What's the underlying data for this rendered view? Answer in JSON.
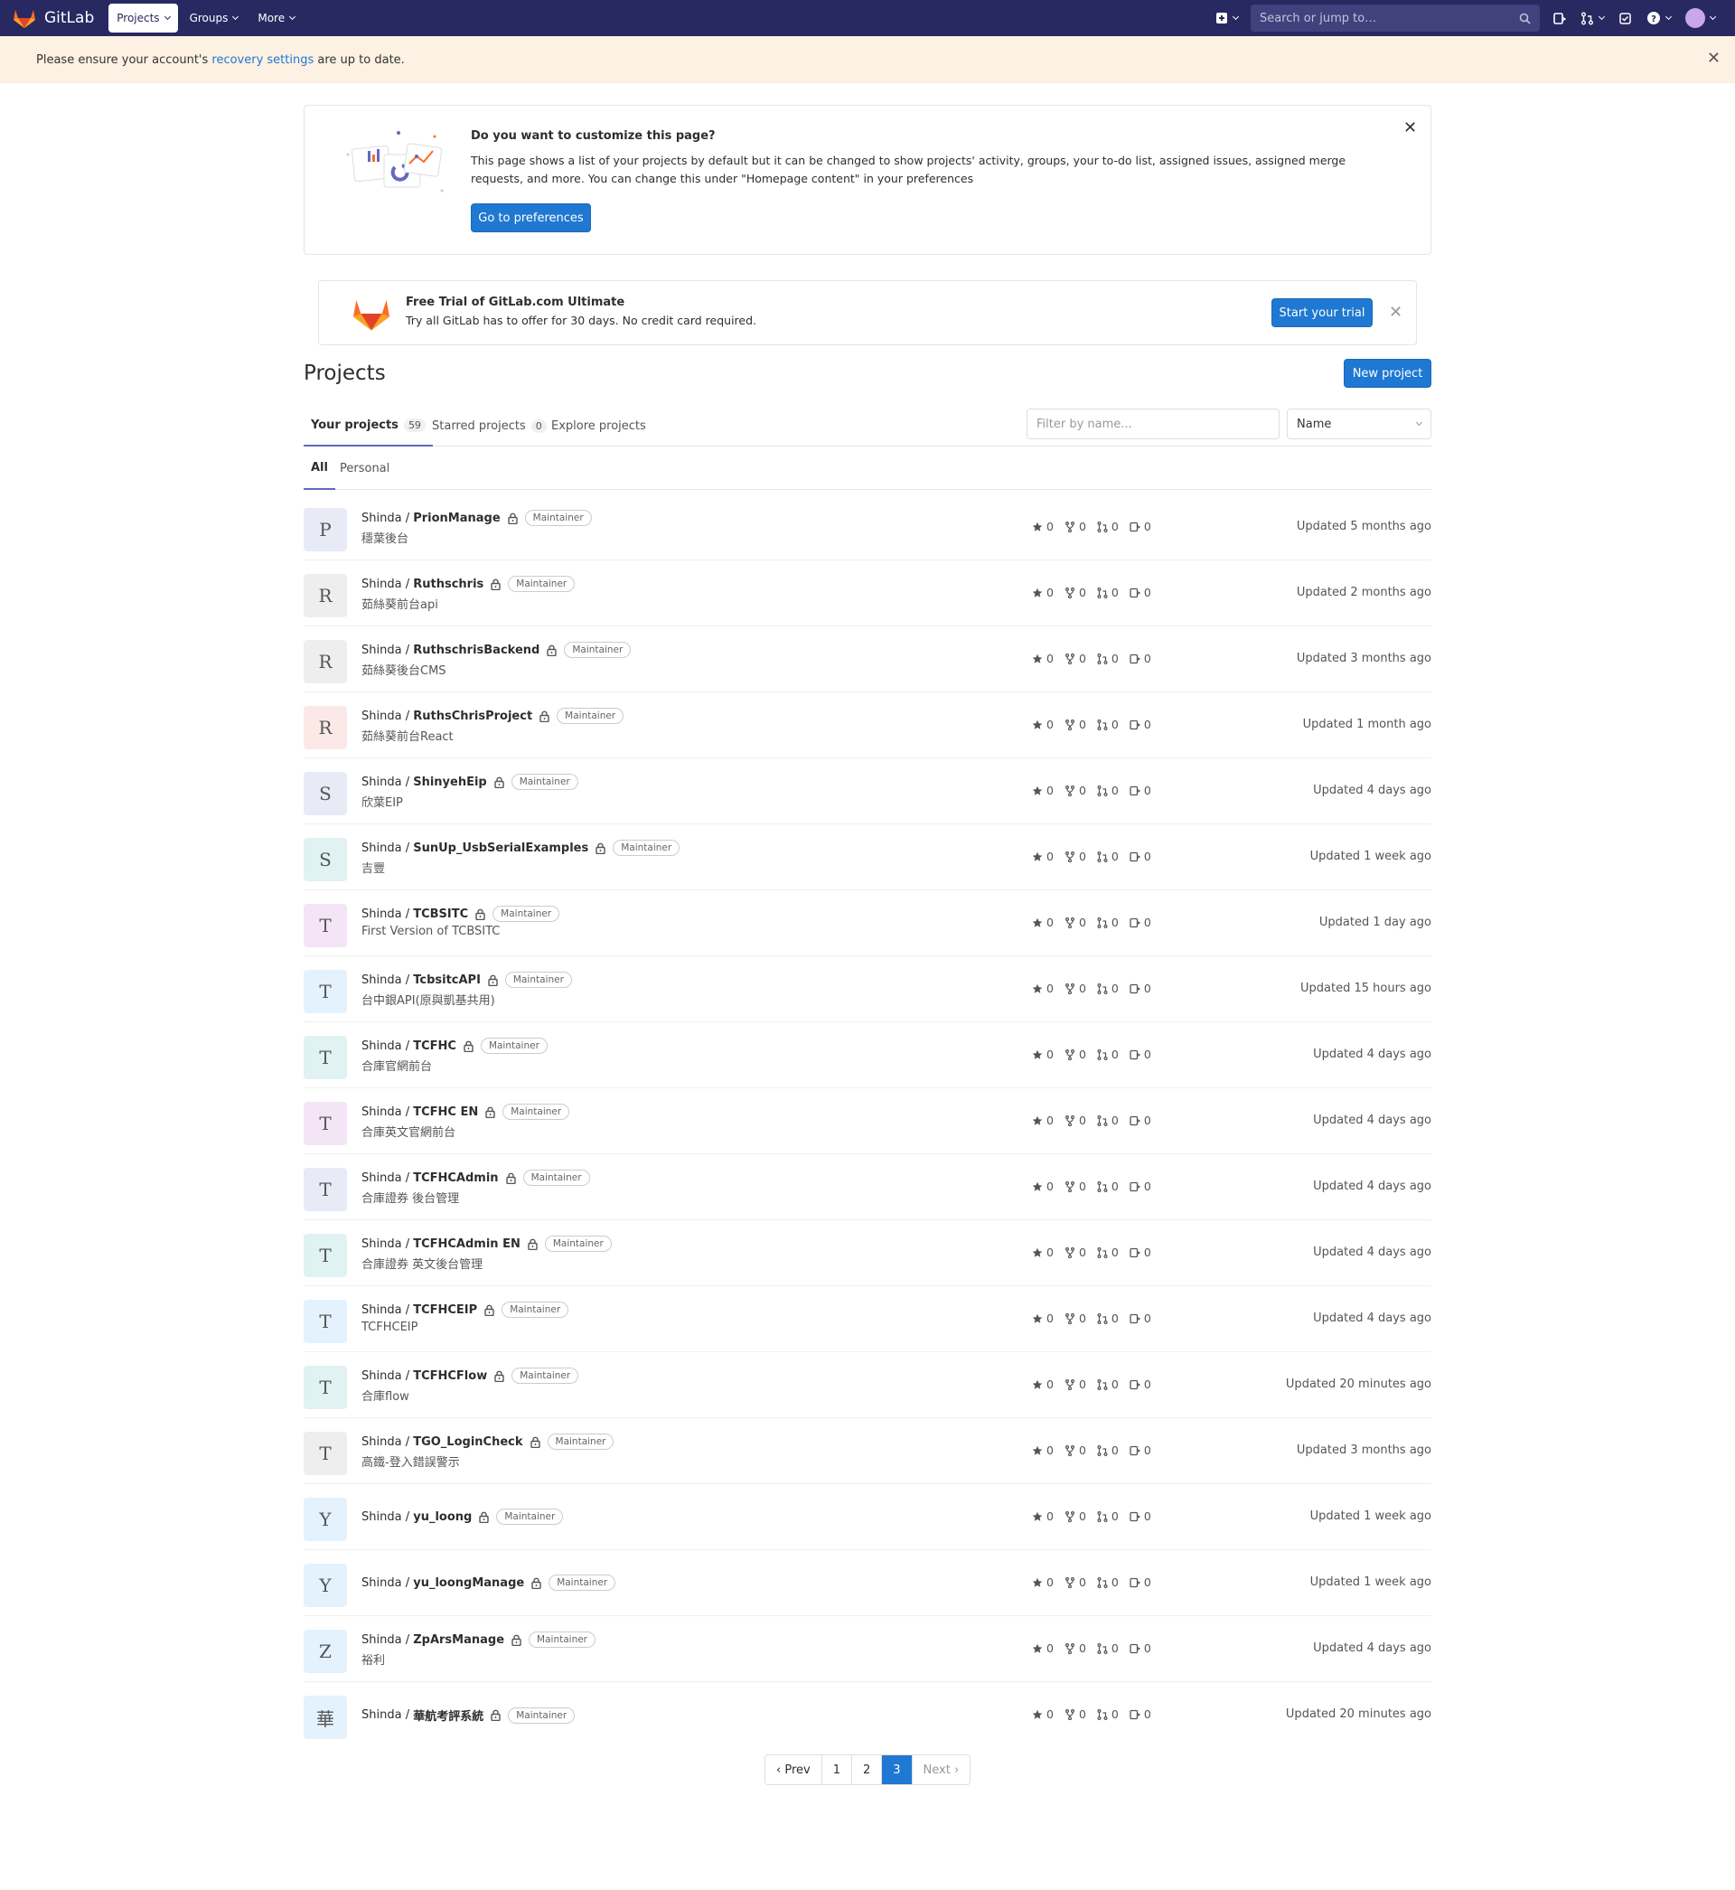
{
  "navbar": {
    "brand": "GitLab",
    "menus": [
      {
        "label": "Projects",
        "active": true
      },
      {
        "label": "Groups",
        "active": false
      },
      {
        "label": "More",
        "active": false
      }
    ],
    "search_placeholder": "Search or jump to…"
  },
  "alert": {
    "prefix": "Please ensure your account's ",
    "link": "recovery settings",
    "suffix": " are up to date."
  },
  "customize": {
    "title": "Do you want to customize this page?",
    "text": "This page shows a list of your projects by default but it can be changed to show projects' activity, groups, your to-do list, assigned issues, assigned merge requests, and more. You can change this under \"Homepage content\" in your preferences",
    "button": "Go to preferences"
  },
  "trial": {
    "title": "Free Trial of GitLab.com Ultimate",
    "text": "Try all GitLab has to offer for 30 days. No credit card required.",
    "button": "Start your trial"
  },
  "projects": {
    "title": "Projects",
    "new_button": "New project",
    "tabs": [
      {
        "label": "Your projects",
        "count": "59"
      },
      {
        "label": "Starred projects",
        "count": "0"
      },
      {
        "label": "Explore projects",
        "count": ""
      }
    ],
    "filter_placeholder": "Filter by name...",
    "sort": "Name",
    "subtabs": [
      "All",
      "Personal"
    ],
    "namespace": "Shinda / ",
    "role": "Maintainer",
    "items": [
      {
        "letter": "P",
        "name": "PrionManage",
        "desc": "穩葉後台",
        "color": "#e8eaf6",
        "stars": "0",
        "forks": "0",
        "mrs": "0",
        "issues": "0",
        "updated": "Updated 5 months ago"
      },
      {
        "letter": "R",
        "name": "Ruthschris",
        "desc": "茹絲葵前台api",
        "color": "#eeeeee",
        "stars": "0",
        "forks": "0",
        "mrs": "0",
        "issues": "0",
        "updated": "Updated 2 months ago"
      },
      {
        "letter": "R",
        "name": "RuthschrisBackend",
        "desc": "茹絲葵後台CMS",
        "color": "#eeeeee",
        "stars": "0",
        "forks": "0",
        "mrs": "0",
        "issues": "0",
        "updated": "Updated 3 months ago"
      },
      {
        "letter": "R",
        "name": "RuthsChrisProject",
        "desc": "茹絲葵前台React",
        "color": "#fbe9e7",
        "stars": "0",
        "forks": "0",
        "mrs": "0",
        "issues": "0",
        "updated": "Updated 1 month ago"
      },
      {
        "letter": "S",
        "name": "ShinyehEip",
        "desc": "欣葉EIP",
        "color": "#e8eaf6",
        "stars": "0",
        "forks": "0",
        "mrs": "0",
        "issues": "0",
        "updated": "Updated 4 days ago"
      },
      {
        "letter": "S",
        "name": "SunUp_UsbSerialExamples",
        "desc": "吉豐",
        "color": "#e0f2f1",
        "stars": "0",
        "forks": "0",
        "mrs": "0",
        "issues": "0",
        "updated": "Updated 1 week ago"
      },
      {
        "letter": "T",
        "name": "TCBSITC",
        "desc": "First Version of TCBSITC",
        "color": "#f3e5f5",
        "stars": "0",
        "forks": "0",
        "mrs": "0",
        "issues": "0",
        "updated": "Updated 1 day ago"
      },
      {
        "letter": "T",
        "name": "TcbsitcAPI",
        "desc": "台中銀API(原與凱基共用)",
        "color": "#e3f2fd",
        "stars": "0",
        "forks": "0",
        "mrs": "0",
        "issues": "0",
        "updated": "Updated 15 hours ago"
      },
      {
        "letter": "T",
        "name": "TCFHC",
        "desc": "合庫官網前台",
        "color": "#e0f2f1",
        "stars": "0",
        "forks": "0",
        "mrs": "0",
        "issues": "0",
        "updated": "Updated 4 days ago"
      },
      {
        "letter": "T",
        "name": "TCFHC EN",
        "desc": "合庫英文官網前台",
        "color": "#f3e5f5",
        "stars": "0",
        "forks": "0",
        "mrs": "0",
        "issues": "0",
        "updated": "Updated 4 days ago"
      },
      {
        "letter": "T",
        "name": "TCFHCAdmin",
        "desc": "合庫證券 後台管理",
        "color": "#e8eaf6",
        "stars": "0",
        "forks": "0",
        "mrs": "0",
        "issues": "0",
        "updated": "Updated 4 days ago"
      },
      {
        "letter": "T",
        "name": "TCFHCAdmin EN",
        "desc": "合庫證券 英文後台管理",
        "color": "#e0f2f1",
        "stars": "0",
        "forks": "0",
        "mrs": "0",
        "issues": "0",
        "updated": "Updated 4 days ago"
      },
      {
        "letter": "T",
        "name": "TCFHCEIP",
        "desc": "TCFHCEIP",
        "color": "#e3f2fd",
        "stars": "0",
        "forks": "0",
        "mrs": "0",
        "issues": "0",
        "updated": "Updated 4 days ago"
      },
      {
        "letter": "T",
        "name": "TCFHCFlow",
        "desc": "合庫flow",
        "color": "#e0f2f1",
        "stars": "0",
        "forks": "0",
        "mrs": "0",
        "issues": "0",
        "updated": "Updated 20 minutes ago"
      },
      {
        "letter": "T",
        "name": "TGO_LoginCheck",
        "desc": "高鐵-登入錯誤警示",
        "color": "#eeeeee",
        "stars": "0",
        "forks": "0",
        "mrs": "0",
        "issues": "0",
        "updated": "Updated 3 months ago"
      },
      {
        "letter": "Y",
        "name": "yu_loong",
        "desc": "",
        "color": "#e3f2fd",
        "stars": "0",
        "forks": "0",
        "mrs": "0",
        "issues": "0",
        "updated": "Updated 1 week ago"
      },
      {
        "letter": "Y",
        "name": "yu_loongManage",
        "desc": "",
        "color": "#e3f2fd",
        "stars": "0",
        "forks": "0",
        "mrs": "0",
        "issues": "0",
        "updated": "Updated 1 week ago"
      },
      {
        "letter": "Z",
        "name": "ZpArsManage",
        "desc": "裕利",
        "color": "#e3f2fd",
        "stars": "0",
        "forks": "0",
        "mrs": "0",
        "issues": "0",
        "updated": "Updated 4 days ago"
      },
      {
        "letter": "華",
        "name": "華航考評系統",
        "desc": "",
        "color": "#e3f2fd",
        "stars": "0",
        "forks": "0",
        "mrs": "0",
        "issues": "0",
        "updated": "Updated 20 minutes ago"
      }
    ]
  },
  "pagination": {
    "prev": "‹ Prev",
    "pages": [
      "1",
      "2",
      "3"
    ],
    "current": "3",
    "next": "Next ›"
  }
}
